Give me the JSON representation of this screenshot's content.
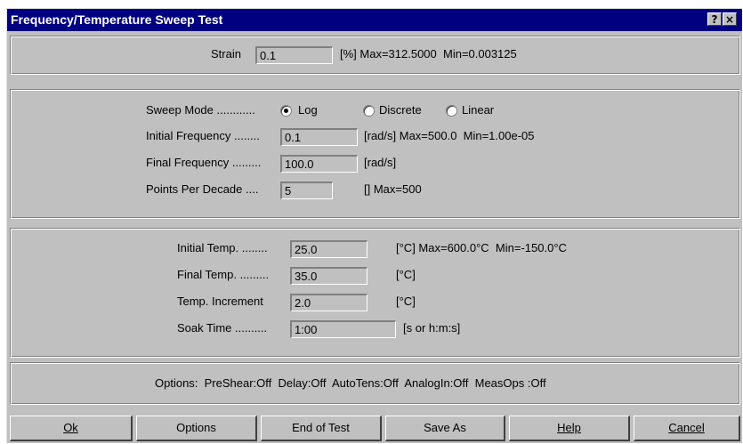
{
  "window": {
    "title": "Frequency/Temperature Sweep Test",
    "help_glyph": "?",
    "close_glyph": "×"
  },
  "strain": {
    "label": "Strain",
    "value": "0.1",
    "range": "[%] Max=312.5000  Min=0.003125"
  },
  "sweep": {
    "mode_label": "Sweep Mode ............",
    "modes": [
      {
        "label": "Log",
        "selected": true
      },
      {
        "label": "Discrete",
        "selected": false
      },
      {
        "label": "Linear",
        "selected": false
      }
    ],
    "initial_freq_label": "Initial Frequency ........",
    "initial_freq_value": "0.1",
    "initial_freq_range": "[rad/s] Max=500.0  Min=1.00e-05",
    "final_freq_label": "Final Frequency .........",
    "final_freq_value": "100.0",
    "final_freq_unit": "[rad/s]",
    "ppd_label": "Points Per Decade ....",
    "ppd_value": "5",
    "ppd_range": "[] Max=500"
  },
  "temp": {
    "initial_label": "Initial Temp. ........",
    "initial_value": "25.0",
    "initial_range": "[°C] Max=600.0°C  Min=-150.0°C",
    "final_label": "Final Temp. .........",
    "final_value": "35.0",
    "final_unit": "[°C]",
    "increment_label": "Temp. Increment",
    "increment_value": "2.0",
    "increment_unit": "[°C]",
    "soak_label": "Soak Time ..........",
    "soak_value": "1:00",
    "soak_unit": "[s or h:m:s]"
  },
  "options_line": "Options:  PreShear:Off  Delay:Off  AutoTens:Off  AnalogIn:Off  MeasOps :Off",
  "buttons": {
    "ok": "Ok",
    "options": "Options",
    "end_of_test": "End of Test",
    "save_as": "Save As",
    "help": "Help",
    "cancel": "Cancel"
  }
}
